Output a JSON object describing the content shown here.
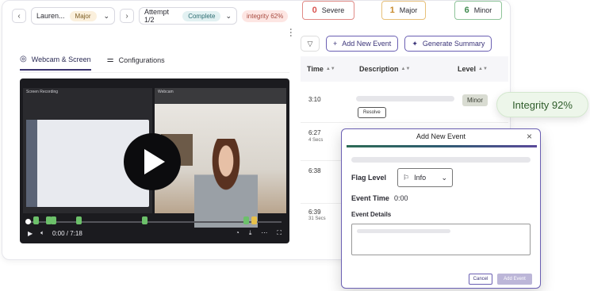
{
  "topbar": {
    "candidate_name": "Lauren...",
    "candidate_badge": "Major",
    "attempt": "Attempt 1/2",
    "attempt_status": "Complete",
    "integrity_badge": "integrity 62%"
  },
  "counts": [
    {
      "value": "0",
      "label": "Severe",
      "color": "#d9534f"
    },
    {
      "value": "1",
      "label": "Major",
      "color": "#e1a64b"
    },
    {
      "value": "6",
      "label": "Minor",
      "color": "#3f8a4f"
    }
  ],
  "tabs": {
    "webcam": "Webcam & Screen",
    "configurations": "Configurations"
  },
  "player": {
    "screen_label": "Screen Recording",
    "webcam_label": "Webcam",
    "time": "0:00 / 7:18",
    "progress": 0.0,
    "markers": [
      {
        "pos": 0.03,
        "type": "g"
      },
      {
        "pos": 0.08,
        "type": "g"
      },
      {
        "pos": 0.1,
        "type": "g"
      },
      {
        "pos": 0.2,
        "type": "g"
      },
      {
        "pos": 0.46,
        "type": "g"
      },
      {
        "pos": 0.86,
        "type": "g"
      },
      {
        "pos": 0.89,
        "type": "y"
      }
    ]
  },
  "toolbar": {
    "add_event": "Add New Event",
    "generate_summary": "Generate Summary"
  },
  "table": {
    "headers": {
      "time": "Time",
      "description": "Description",
      "level": "Level"
    },
    "rows": [
      {
        "time": "3:10",
        "sub": "",
        "level": "Minor",
        "resolve": "Resolve"
      },
      {
        "time": "6:27",
        "sub": "4 Secs"
      },
      {
        "time": "6:38",
        "sub": ""
      },
      {
        "time": "6:39",
        "sub": "31 Secs"
      }
    ]
  },
  "integrity_float": "Integrity 92%",
  "modal": {
    "title": "Add New Event",
    "flag_level_label": "Flag Level",
    "flag_level_value": "Info",
    "event_time_label": "Event Time",
    "event_time_value": "0:00",
    "event_details_label": "Event Details",
    "cancel": "Cancel",
    "add": "Add Event"
  }
}
